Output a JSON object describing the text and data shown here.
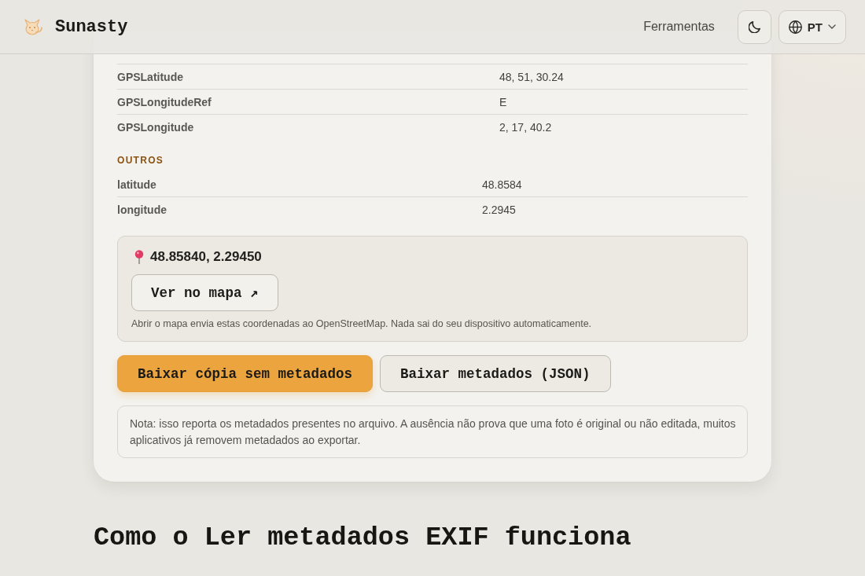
{
  "header": {
    "brand": "Sunasty",
    "nav_link": "Ferramentas",
    "language": "PT"
  },
  "metadata": {
    "sections": [
      {
        "rows": [
          {
            "key": "GPSLatitude",
            "value": "48, 51, 30.24"
          },
          {
            "key": "GPSLongitudeRef",
            "value": "E"
          },
          {
            "key": "GPSLongitude",
            "value": "2, 17, 40.2"
          }
        ]
      },
      {
        "title": "OUTROS",
        "rows": [
          {
            "key": "latitude",
            "value": "48.8584"
          },
          {
            "key": "longitude",
            "value": "2.2945"
          }
        ]
      }
    ]
  },
  "location": {
    "coordinates": "48.85840, 2.29450",
    "map_button": "Ver no mapa ↗",
    "notice": "Abrir o mapa envia estas coordenadas ao OpenStreetMap. Nada sai do seu dispositivo automaticamente."
  },
  "actions": [
    {
      "label": "Baixar cópia sem metadados",
      "kind": "primary"
    },
    {
      "label": "Baixar metadados (JSON)",
      "kind": "secondary"
    }
  ],
  "note": "Nota: isso reporta os metadados presentes no arquivo. A ausência não prova que uma foto é original ou não editada, muitos aplicativos já removem metadados ao exportar.",
  "section_heading": "Como o Ler metadados EXIF funciona"
}
